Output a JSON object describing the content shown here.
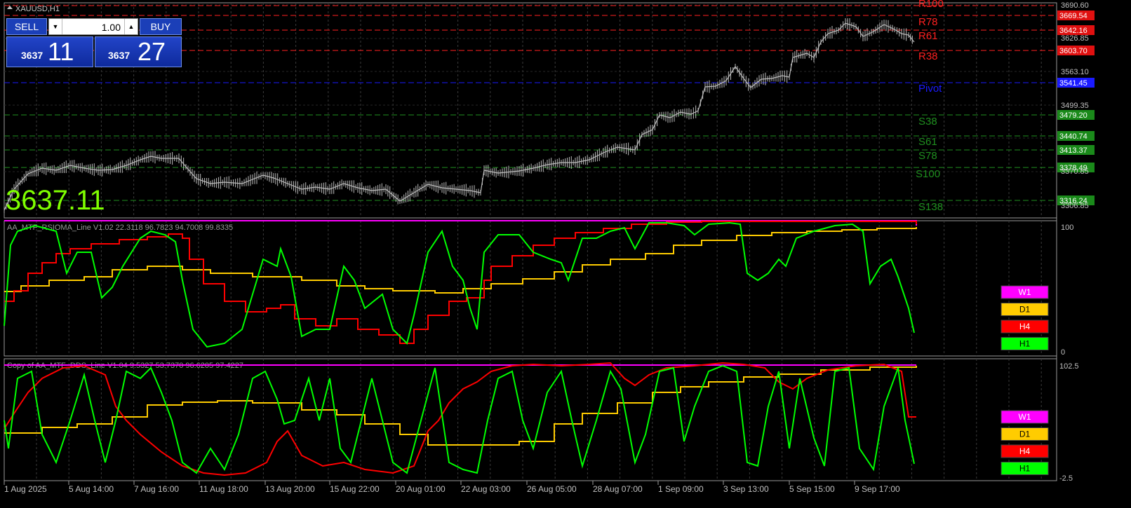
{
  "symbol_label": "XAUUSD,H1",
  "trade_panel": {
    "sell_label": "SELL",
    "buy_label": "BUY",
    "lot_value": "1.00",
    "sell_price_small": "3637",
    "sell_price_big": "11",
    "buy_price_small": "3637",
    "buy_price_big": "27"
  },
  "big_price": "3637.11",
  "main_axis_labels": [
    "3690.60",
    "3626.85",
    "3563.10",
    "3499.35",
    "3370.85",
    "3306.85"
  ],
  "levels": [
    {
      "name": "R100",
      "label": "R100",
      "price_tag": "",
      "color": "#ff2020"
    },
    {
      "name": "R78",
      "label": "R78",
      "price_tag": "3669.54",
      "color": "#ff2020"
    },
    {
      "name": "R61",
      "label": "R61",
      "price_tag": "3642.16",
      "color": "#ff2020"
    },
    {
      "name": "R38",
      "label": "R38",
      "price_tag": "3603.70",
      "color": "#ff2020"
    },
    {
      "name": "Pivot",
      "label": "Pivot",
      "price_tag": "3541.45",
      "color": "#1a1aff"
    },
    {
      "name": "S38",
      "label": "S38",
      "price_tag": "3479.20",
      "color": "#1f8f1f"
    },
    {
      "name": "S61",
      "label": "S61",
      "price_tag": "3440.74",
      "color": "#1f8f1f"
    },
    {
      "name": "S78",
      "label": "S78",
      "price_tag": "3413.37",
      "color": "#1f8f1f"
    },
    {
      "name": "S100",
      "label": "S100",
      "price_tag": "3378.49",
      "color": "#1f8f1f"
    },
    {
      "name": "S138",
      "label": "S138",
      "price_tag": "3316.24",
      "color": "#1f8f1f"
    }
  ],
  "indicator1": {
    "title": "AA_MTF_RSIOMA_Line V1.02 22.3118 96.7823 94.7008 99.8335",
    "axis_top": "100",
    "axis_bottom": "0"
  },
  "indicator2": {
    "title": "Copy of AA_MTF_DDS_Line V1.04 9.5327 53.7370 96.6205 97.4227",
    "axis_top": "102.5",
    "axis_bottom": "-2.5"
  },
  "legend": [
    {
      "label": "W1",
      "color": "#ff00ff"
    },
    {
      "label": "D1",
      "color": "#ffcc00"
    },
    {
      "label": "H4",
      "color": "#ff0000"
    },
    {
      "label": "H1",
      "color": "#00ff00"
    }
  ],
  "time_labels": [
    "1 Aug 2025",
    "5 Aug 14:00",
    "7 Aug 16:00",
    "11 Aug 18:00",
    "13 Aug 20:00",
    "15 Aug 22:00",
    "20 Aug 01:00",
    "22 Aug 03:00",
    "26 Aug 05:00",
    "28 Aug 07:00",
    "1 Sep 09:00",
    "3 Sep 13:00",
    "5 Sep 15:00",
    "9 Sep 17:00"
  ],
  "colors": {
    "grid": "#3a3a3a",
    "price_line": "#bdbdbd",
    "w1": "#ff00ff",
    "d1": "#ffcc00",
    "h4": "#ff0000",
    "h1": "#00ff00",
    "big_price": "#7fff00"
  }
}
